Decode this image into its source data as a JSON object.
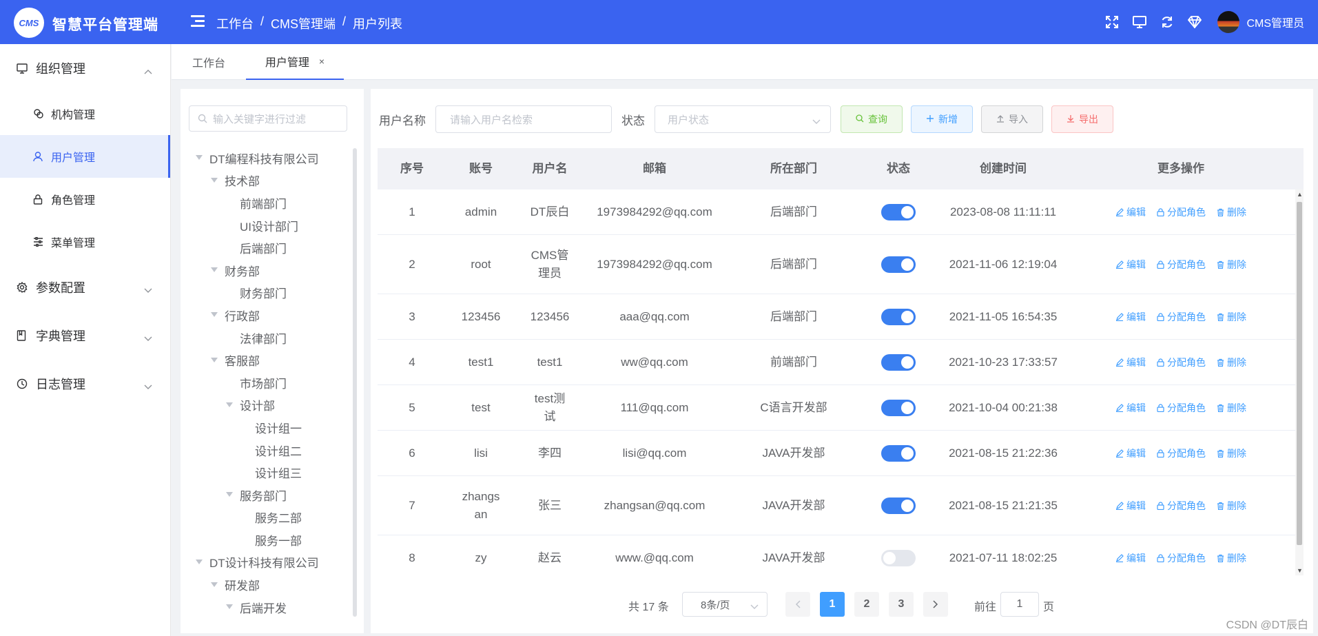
{
  "header": {
    "logo_text": "CMS",
    "title": "智慧平台管理端",
    "breadcrumb": [
      "工作台",
      "CMS管理端",
      "用户列表"
    ],
    "user_name": "CMS管理员"
  },
  "sidebar": {
    "groups": [
      {
        "label": "组织管理",
        "icon": "monitor-icon",
        "expanded": true
      },
      {
        "label": "参数配置",
        "icon": "gear-icon",
        "expanded": false
      },
      {
        "label": "字典管理",
        "icon": "book-icon",
        "expanded": false
      },
      {
        "label": "日志管理",
        "icon": "clock-icon",
        "expanded": false
      }
    ],
    "sub_items": [
      {
        "label": "机构管理",
        "icon": "link-icon"
      },
      {
        "label": "用户管理",
        "icon": "user-icon",
        "active": true
      },
      {
        "label": "角色管理",
        "icon": "lock-icon"
      },
      {
        "label": "菜单管理",
        "icon": "sliders-icon"
      }
    ]
  },
  "tabs": [
    {
      "label": "工作台"
    },
    {
      "label": "用户管理",
      "active": true,
      "close": "×"
    }
  ],
  "tree": {
    "placeholder": "输入关键字进行过滤",
    "nodes": [
      {
        "label": "DT编程科技有限公司",
        "level": 0,
        "has_children": true
      },
      {
        "label": "技术部",
        "level": 1,
        "has_children": true
      },
      {
        "label": "前端部门",
        "level": 2,
        "has_children": false
      },
      {
        "label": "UI设计部门",
        "level": 2,
        "has_children": false
      },
      {
        "label": "后端部门",
        "level": 2,
        "has_children": false
      },
      {
        "label": "财务部",
        "level": 1,
        "has_children": true
      },
      {
        "label": "财务部门",
        "level": 2,
        "has_children": false
      },
      {
        "label": "行政部",
        "level": 1,
        "has_children": true
      },
      {
        "label": "法律部门",
        "level": 2,
        "has_children": false
      },
      {
        "label": "客服部",
        "level": 1,
        "has_children": true
      },
      {
        "label": "市场部门",
        "level": 2,
        "has_children": false
      },
      {
        "label": "设计部",
        "level": 2,
        "has_children": true
      },
      {
        "label": "设计组一",
        "level": 3,
        "has_children": false
      },
      {
        "label": "设计组二",
        "level": 3,
        "has_children": false
      },
      {
        "label": "设计组三",
        "level": 3,
        "has_children": false
      },
      {
        "label": "服务部门",
        "level": 2,
        "has_children": true
      },
      {
        "label": "服务二部",
        "level": 3,
        "has_children": false
      },
      {
        "label": "服务一部",
        "level": 3,
        "has_children": false
      },
      {
        "label": "DT设计科技有限公司",
        "level": 0,
        "has_children": true
      },
      {
        "label": "研发部",
        "level": 1,
        "has_children": true
      },
      {
        "label": "后端开发",
        "level": 2,
        "has_children": true
      }
    ]
  },
  "filters": {
    "username_label": "用户名称",
    "username_placeholder": "请输入用户名检索",
    "status_label": "状态",
    "status_placeholder": "用户状态",
    "query_label": "查询",
    "add_label": "新增",
    "import_label": "导入",
    "export_label": "导出"
  },
  "table": {
    "columns": [
      "序号",
      "账号",
      "用户名",
      "邮箱",
      "所在部门",
      "状态",
      "创建时间",
      "更多操作"
    ],
    "rows": [
      {
        "no": "1",
        "account": "admin",
        "name": "DT辰白",
        "email": "1973984292@qq.com",
        "dept": "后端部门",
        "enabled": true,
        "created": "2023-08-08 11:11:11"
      },
      {
        "no": "2",
        "account": "root",
        "name": "CMS管理员",
        "email": "1973984292@qq.com",
        "dept": "后端部门",
        "enabled": true,
        "created": "2021-11-06 12:19:04"
      },
      {
        "no": "3",
        "account": "123456",
        "name": "123456",
        "email": "aaa@qq.com",
        "dept": "后端部门",
        "enabled": true,
        "created": "2021-11-05 16:54:35"
      },
      {
        "no": "4",
        "account": "test1",
        "name": "test1",
        "email": "ww@qq.com",
        "dept": "前端部门",
        "enabled": true,
        "created": "2021-10-23 17:33:57"
      },
      {
        "no": "5",
        "account": "test",
        "name": "test测试",
        "email": "111@qq.com",
        "dept": "C语言开发部",
        "enabled": true,
        "created": "2021-10-04 00:21:38"
      },
      {
        "no": "6",
        "account": "lisi",
        "name": "李四",
        "email": "lisi@qq.com",
        "dept": "JAVA开发部",
        "enabled": true,
        "created": "2021-08-15 21:22:36"
      },
      {
        "no": "7",
        "account": "zhangsan",
        "name": "张三",
        "email": "zhangsan@qq.com",
        "dept": "JAVA开发部",
        "enabled": true,
        "created": "2021-08-15 21:21:35"
      },
      {
        "no": "8",
        "account": "zy",
        "name": "赵云",
        "email": "www.@qq.com",
        "dept": "JAVA开发部",
        "enabled": false,
        "created": "2021-07-11 18:02:25"
      }
    ],
    "ops": {
      "edit": "编辑",
      "assign": "分配角色",
      "delete": "删除"
    }
  },
  "pagination": {
    "total_text": "共 17 条",
    "page_size": "8条/页",
    "pages": [
      "1",
      "2",
      "3"
    ],
    "current": "1",
    "goto_label": "前往",
    "goto_value": "1",
    "page_suffix": "页"
  },
  "watermark": "CSDN @DT辰白",
  "colors": {
    "primary": "#3a63f0",
    "switch_on": "#3a7ff0",
    "link": "#409eff"
  }
}
